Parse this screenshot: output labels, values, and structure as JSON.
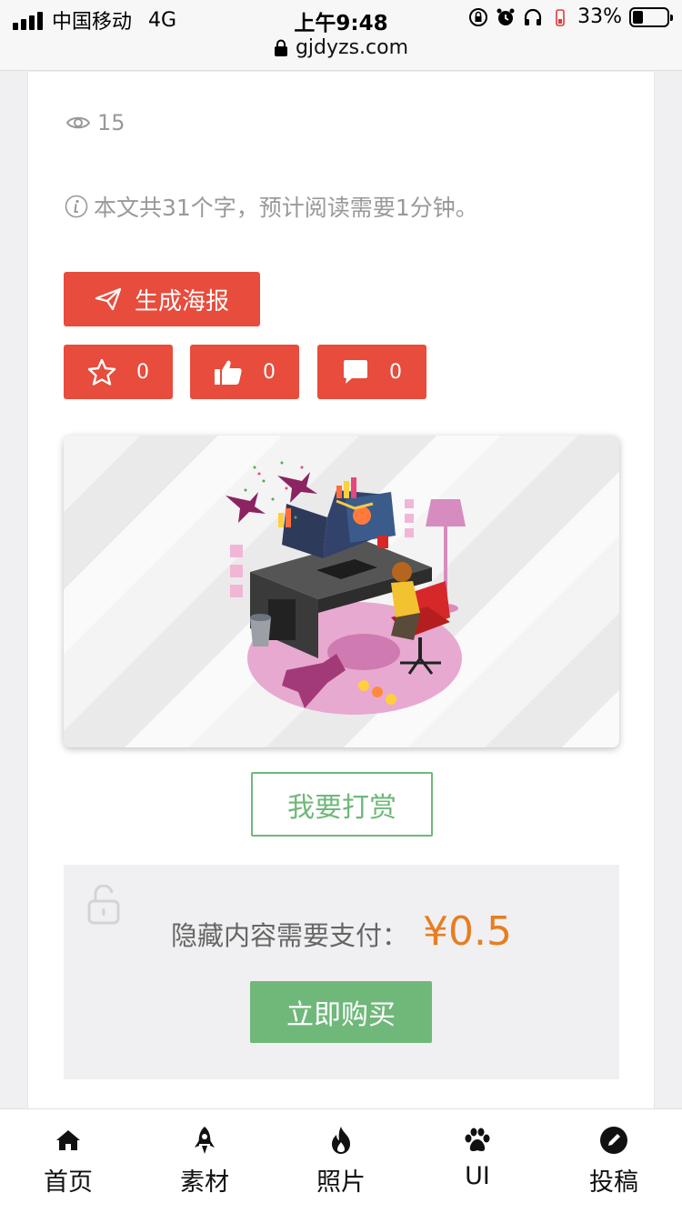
{
  "status": {
    "carrier": "中国移动",
    "network": "4G",
    "time": "上午9:48",
    "battery": "33%",
    "url": "gjdyzs.com"
  },
  "post": {
    "views": "15",
    "read_info": "本文共31个字，预计阅读需要1分钟。",
    "poster_label": "生成海报",
    "favorite_count": "0",
    "like_count": "0",
    "comment_count": "0"
  },
  "reward": {
    "label": "我要打赏"
  },
  "paywall": {
    "label": "隐藏内容需要支付：",
    "price": "¥0.5",
    "buy_label": "立即购买"
  },
  "tabbar": {
    "items": [
      {
        "label": "首页",
        "icon": "home-icon"
      },
      {
        "label": "素材",
        "icon": "rocket-icon"
      },
      {
        "label": "照片",
        "icon": "fire-icon"
      },
      {
        "label": "UI",
        "icon": "paw-icon"
      },
      {
        "label": "投稿",
        "icon": "pencil-icon"
      }
    ]
  },
  "colors": {
    "action_red": "#e74c3c",
    "accent_green": "#6fb87a",
    "price_orange": "#e67e22"
  }
}
